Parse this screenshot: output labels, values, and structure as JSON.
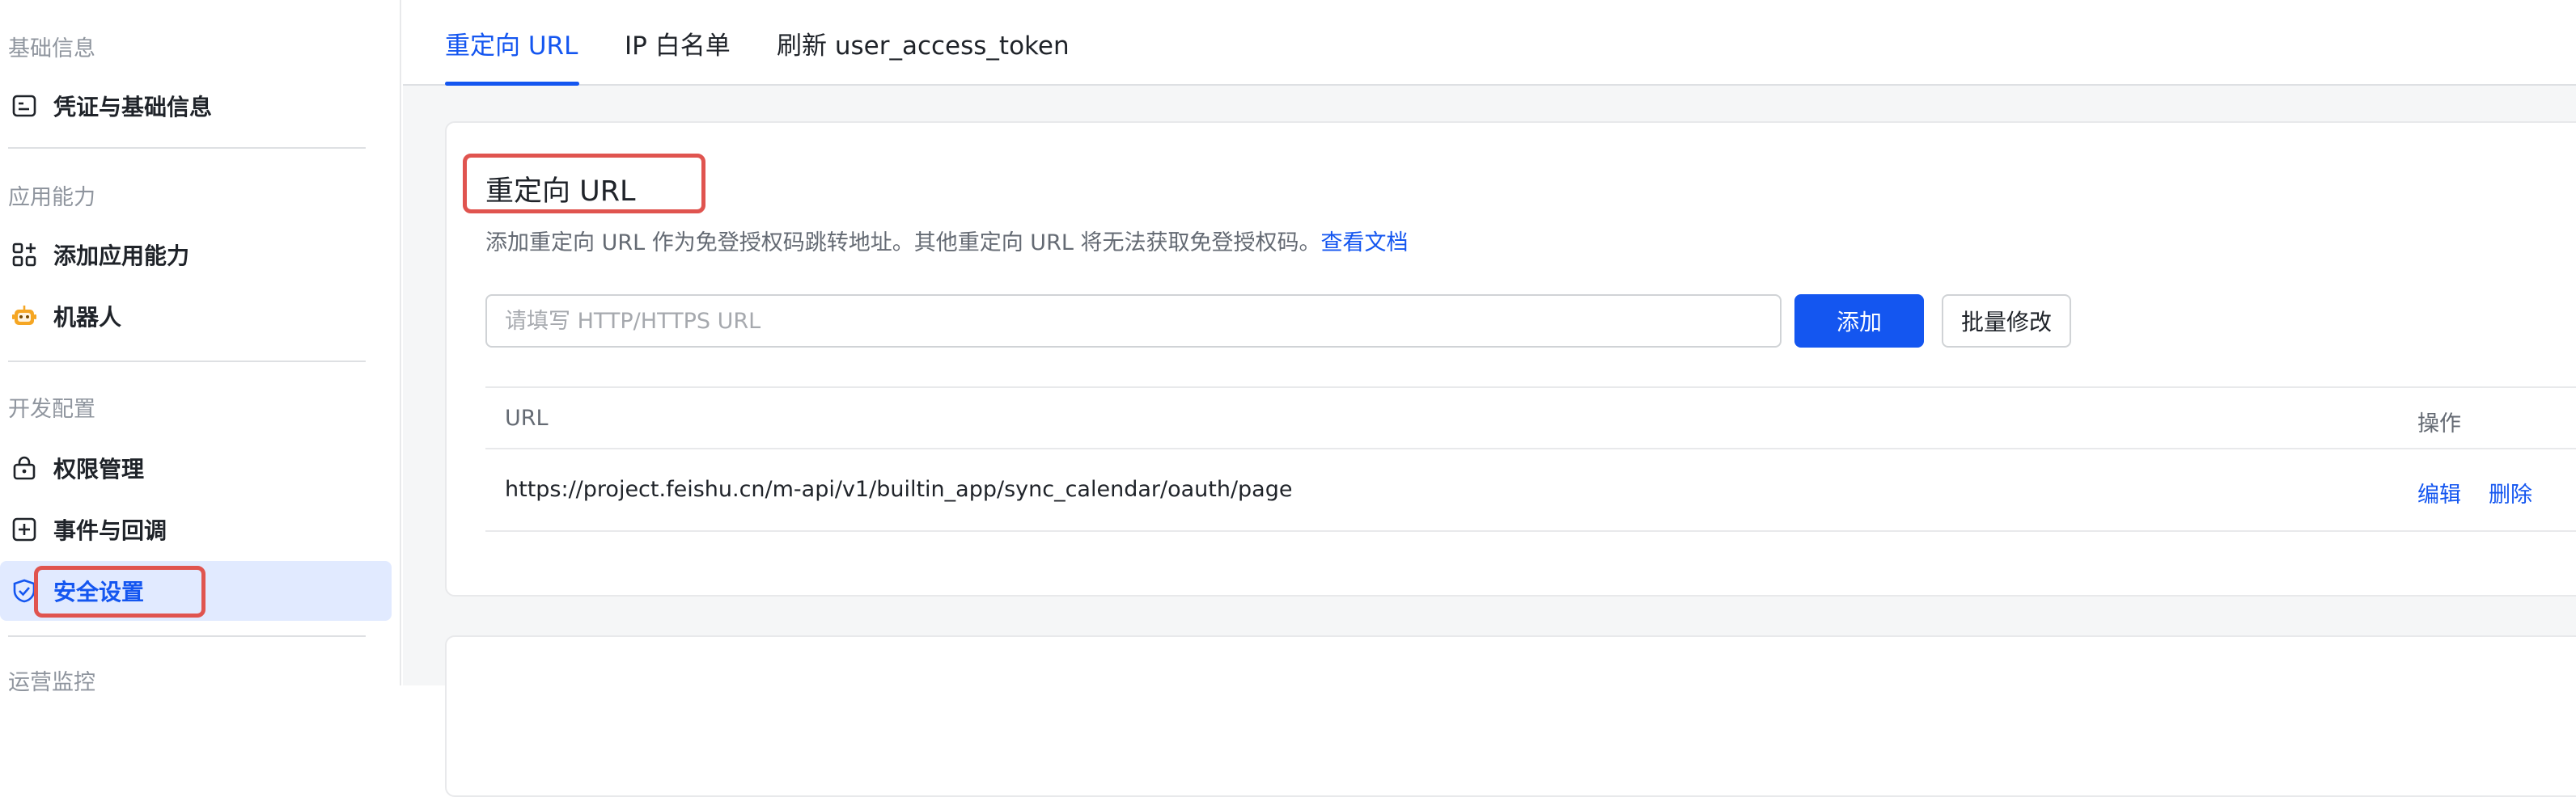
{
  "sidebar": {
    "groups": [
      {
        "title": "基础信息",
        "items": [
          {
            "label": "凭证与基础信息",
            "icon": "credential-icon"
          }
        ]
      },
      {
        "title": "应用能力",
        "items": [
          {
            "label": "添加应用能力",
            "icon": "apps-add-icon"
          },
          {
            "label": "机器人",
            "icon": "robot-icon"
          }
        ]
      },
      {
        "title": "开发配置",
        "items": [
          {
            "label": "权限管理",
            "icon": "lock-icon"
          },
          {
            "label": "事件与回调",
            "icon": "plus-box-icon"
          },
          {
            "label": "安全设置",
            "icon": "shield-icon",
            "active": true
          }
        ]
      },
      {
        "title": "运营监控",
        "items": []
      }
    ]
  },
  "tabs": [
    {
      "label": "重定向 URL",
      "active": true
    },
    {
      "label": "IP 白名单"
    },
    {
      "label": "刷新 user_access_token"
    }
  ],
  "redirect": {
    "title": "重定向 URL",
    "desc": "添加重定向 URL 作为免登授权码跳转地址。其他重定向 URL 将无法获取免登授权码。",
    "doc_link": "查看文档",
    "input_placeholder": "请填写 HTTP/HTTPS URL",
    "add_label": "添加",
    "batch_label": "批量修改",
    "table": {
      "headers": [
        "URL",
        "操作"
      ],
      "rows": [
        {
          "url": "https://project.feishu.cn/m-api/v1/builtin_app/sync_calendar/oauth/page",
          "edit": "编辑",
          "delete": "删除"
        }
      ]
    }
  },
  "colors": {
    "accent": "#1456f0",
    "highlight": "#e0544f",
    "active_bg": "#e1eaff"
  }
}
